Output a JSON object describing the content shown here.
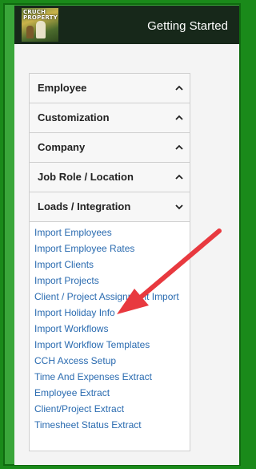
{
  "header": {
    "title": "Getting Started",
    "logo_text": "CRUCH PROPERTY"
  },
  "menu": {
    "sections": [
      {
        "label": "Employee"
      },
      {
        "label": "Customization"
      },
      {
        "label": "Company"
      },
      {
        "label": "Job Role / Location"
      },
      {
        "label": "Loads / Integration"
      }
    ],
    "open_section_items": [
      "Import Employees",
      "Import Employee Rates",
      "Import Clients",
      "Import Projects",
      "Client / Project Assignment Import",
      "Import Holiday Info",
      "Import Workflows",
      "Import Workflow Templates",
      "CCH Axcess Setup",
      "Time And Expenses Extract",
      "Employee Extract",
      "Client/Project Extract",
      "Timesheet Status Extract"
    ]
  },
  "colors": {
    "frame_green": "#3aa63a",
    "header_bg": "#17281a",
    "link_blue": "#2a6bb0",
    "annotation_arrow": "#e8393f"
  }
}
